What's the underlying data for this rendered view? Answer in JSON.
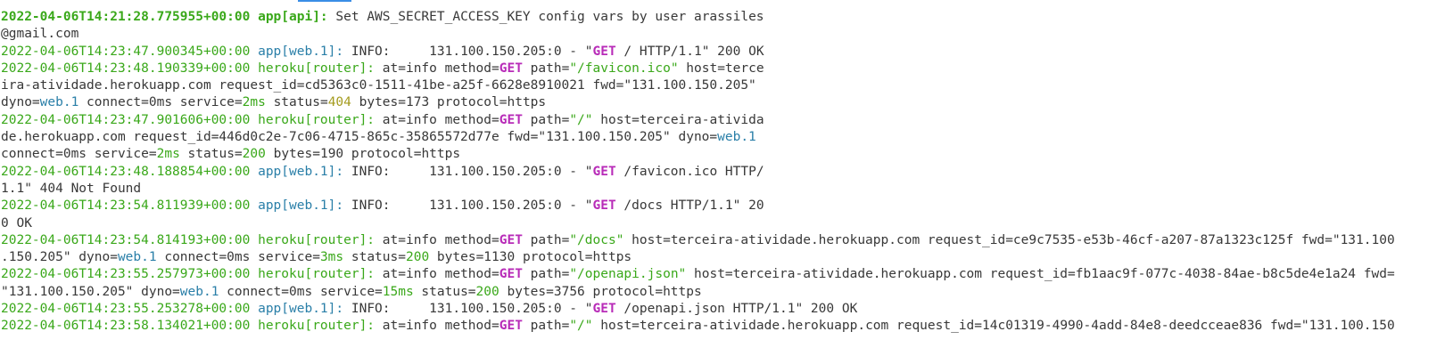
{
  "colors": {
    "timestamp": "#3aa81a",
    "app_process": "#2a7fa8",
    "router_process": "#3aa81a",
    "http_method": "#b82bb8",
    "ok_value": "#3aa81a",
    "dyno_value": "#2a7fa8",
    "warn_status": "#a49b1e",
    "text": "#383838"
  },
  "lines": [
    {
      "segments": [
        {
          "t": "2022-04-06T14:21:28.775955+00:00",
          "c": "ts bold"
        },
        {
          "t": " "
        },
        {
          "t": "app[api]:",
          "c": "proc-api"
        },
        {
          "t": " Set AWS_SECRET_ACCESS_KEY config vars by user arassiles"
        }
      ]
    },
    {
      "segments": [
        {
          "t": "@gmail.com"
        }
      ]
    },
    {
      "segments": [
        {
          "t": "2022-04-06T14:23:47.900345+00:00",
          "c": "ts"
        },
        {
          "t": " "
        },
        {
          "t": "app[web.1]:",
          "c": "proc-app"
        },
        {
          "t": " INFO:     131.100.150.205:0 - \""
        },
        {
          "t": "GET",
          "c": "kw"
        },
        {
          "t": " / HTTP/1.1\" 200 OK"
        }
      ]
    },
    {
      "segments": [
        {
          "t": "2022-04-06T14:23:48.190339+00:00",
          "c": "ts"
        },
        {
          "t": " "
        },
        {
          "t": "heroku[router]:",
          "c": "proc-router"
        },
        {
          "t": " at=info method="
        },
        {
          "t": "GET",
          "c": "kw"
        },
        {
          "t": " path="
        },
        {
          "t": "\"/favicon.ico\"",
          "c": "val-green"
        },
        {
          "t": " host=terce"
        }
      ]
    },
    {
      "segments": [
        {
          "t": "ira-atividade.herokuapp.com request_id=cd5363c0-1511-41be-a25f-6628e8910021 fwd=\"131.100.150.205\""
        }
      ]
    },
    {
      "segments": [
        {
          "t": "dyno="
        },
        {
          "t": "web.1",
          "c": "val-blue"
        },
        {
          "t": " connect=0ms service="
        },
        {
          "t": "2ms",
          "c": "val-green"
        },
        {
          "t": " status="
        },
        {
          "t": "404",
          "c": "val-yellow"
        },
        {
          "t": " bytes=173 protocol=https"
        }
      ]
    },
    {
      "segments": [
        {
          "t": "2022-04-06T14:23:47.901606+00:00",
          "c": "ts"
        },
        {
          "t": " "
        },
        {
          "t": "heroku[router]:",
          "c": "proc-router"
        },
        {
          "t": " at=info method="
        },
        {
          "t": "GET",
          "c": "kw"
        },
        {
          "t": " path="
        },
        {
          "t": "\"/\"",
          "c": "val-green"
        },
        {
          "t": " host=terceira-ativida"
        }
      ]
    },
    {
      "segments": [
        {
          "t": "de.herokuapp.com request_id=446d0c2e-7c06-4715-865c-35865572d77e fwd=\"131.100.150.205\" dyno="
        },
        {
          "t": "web.1",
          "c": "val-blue"
        }
      ]
    },
    {
      "segments": [
        {
          "t": "connect=0ms service="
        },
        {
          "t": "2ms",
          "c": "val-green"
        },
        {
          "t": " status="
        },
        {
          "t": "200",
          "c": "val-green"
        },
        {
          "t": " bytes=190 protocol=https"
        }
      ]
    },
    {
      "segments": [
        {
          "t": "2022-04-06T14:23:48.188854+00:00",
          "c": "ts"
        },
        {
          "t": " "
        },
        {
          "t": "app[web.1]:",
          "c": "proc-app"
        },
        {
          "t": " INFO:     131.100.150.205:0 - \""
        },
        {
          "t": "GET",
          "c": "kw"
        },
        {
          "t": " /favicon.ico HTTP/"
        }
      ]
    },
    {
      "segments": [
        {
          "t": "1.1\" 404 Not Found"
        }
      ]
    },
    {
      "segments": [
        {
          "t": "2022-04-06T14:23:54.811939+00:00",
          "c": "ts"
        },
        {
          "t": " "
        },
        {
          "t": "app[web.1]:",
          "c": "proc-app"
        },
        {
          "t": " INFO:     131.100.150.205:0 - \""
        },
        {
          "t": "GET",
          "c": "kw"
        },
        {
          "t": " /docs HTTP/1.1\" 20"
        }
      ]
    },
    {
      "segments": [
        {
          "t": "0 OK"
        }
      ]
    },
    {
      "segments": [
        {
          "t": "2022-04-06T14:23:54.814193+00:00",
          "c": "ts"
        },
        {
          "t": " "
        },
        {
          "t": "heroku[router]:",
          "c": "proc-router"
        },
        {
          "t": " at=info method="
        },
        {
          "t": "GET",
          "c": "kw"
        },
        {
          "t": " path="
        },
        {
          "t": "\"/docs\"",
          "c": "val-green"
        },
        {
          "t": " host=terceira-atividade.herokuapp.com request_id=ce9c7535-e53b-46cf-a207-87a1323c125f fwd=\"131.100"
        }
      ]
    },
    {
      "segments": [
        {
          "t": ".150.205\" dyno="
        },
        {
          "t": "web.1",
          "c": "val-blue"
        },
        {
          "t": " connect=0ms service="
        },
        {
          "t": "3ms",
          "c": "val-green"
        },
        {
          "t": " status="
        },
        {
          "t": "200",
          "c": "val-green"
        },
        {
          "t": " bytes=1130 protocol=https"
        }
      ]
    },
    {
      "segments": [
        {
          "t": "2022-04-06T14:23:55.257973+00:00",
          "c": "ts"
        },
        {
          "t": " "
        },
        {
          "t": "heroku[router]:",
          "c": "proc-router"
        },
        {
          "t": " at=info method="
        },
        {
          "t": "GET",
          "c": "kw"
        },
        {
          "t": " path="
        },
        {
          "t": "\"/openapi.json\"",
          "c": "val-green"
        },
        {
          "t": " host=terceira-atividade.herokuapp.com request_id=fb1aac9f-077c-4038-84ae-b8c5de4e1a24 fwd="
        }
      ]
    },
    {
      "segments": [
        {
          "t": "\"131.100.150.205\" dyno="
        },
        {
          "t": "web.1",
          "c": "val-blue"
        },
        {
          "t": " connect=0ms service="
        },
        {
          "t": "15ms",
          "c": "val-green"
        },
        {
          "t": " status="
        },
        {
          "t": "200",
          "c": "val-green"
        },
        {
          "t": " bytes=3756 protocol=https"
        }
      ]
    },
    {
      "segments": [
        {
          "t": "2022-04-06T14:23:55.253278+00:00",
          "c": "ts"
        },
        {
          "t": " "
        },
        {
          "t": "app[web.1]:",
          "c": "proc-app"
        },
        {
          "t": " INFO:     131.100.150.205:0 - \""
        },
        {
          "t": "GET",
          "c": "kw"
        },
        {
          "t": " /openapi.json HTTP/1.1\" 200 OK"
        }
      ]
    },
    {
      "segments": [
        {
          "t": "2022-04-06T14:23:58.134021+00:00",
          "c": "ts"
        },
        {
          "t": " "
        },
        {
          "t": "heroku[router]:",
          "c": "proc-router"
        },
        {
          "t": " at=info method="
        },
        {
          "t": "GET",
          "c": "kw"
        },
        {
          "t": " path="
        },
        {
          "t": "\"/\"",
          "c": "val-green"
        },
        {
          "t": " host=terceira-atividade.herokuapp.com request_id=14c01319-4990-4add-84e8-deedcceae836 fwd=\"131.100.150"
        }
      ]
    }
  ]
}
